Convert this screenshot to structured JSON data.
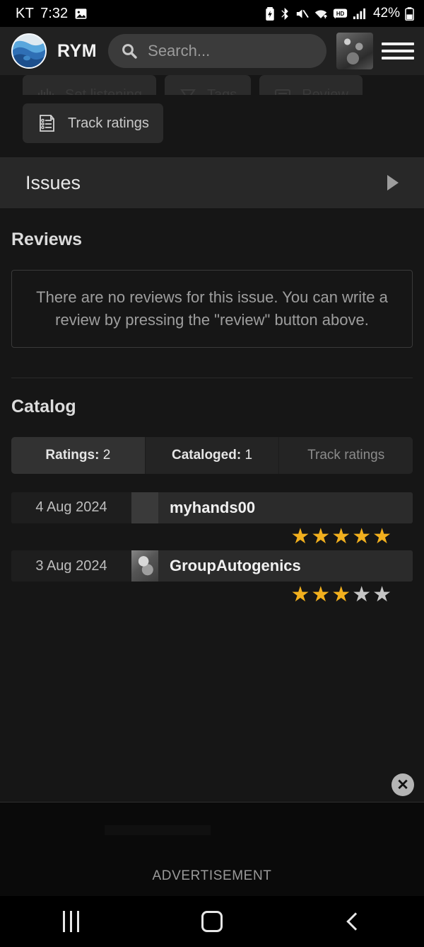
{
  "status_bar": {
    "carrier": "KT",
    "time": "7:32",
    "battery_percent": "42%",
    "icons": [
      "image-icon",
      "battery-saver-icon",
      "bluetooth-icon",
      "mute-icon",
      "wifi-icon",
      "hd-icon",
      "signal-bars-icon",
      "battery-icon"
    ]
  },
  "app_bar": {
    "brand": "RYM",
    "search_placeholder": "Search...",
    "search_value": "",
    "avatar_name": "user-avatar",
    "menu_name": "hamburger-menu"
  },
  "action_buttons_clipped": [
    {
      "label": "Set listening",
      "icon": "waveform-icon"
    },
    {
      "label": "Tags",
      "icon": "tag-icon"
    },
    {
      "label": "Review",
      "icon": "note-icon"
    }
  ],
  "action_buttons": [
    {
      "label": "Track ratings",
      "icon": "track-ratings-icon"
    }
  ],
  "issues": {
    "label": "Issues",
    "chevron": "chevron-right-icon"
  },
  "reviews": {
    "title": "Reviews",
    "empty_message": "There are no reviews for this issue. You can write a review by pressing the \"review\" button above."
  },
  "catalog": {
    "title": "Catalog",
    "tabs": [
      {
        "label": "Ratings:",
        "count": "2",
        "active": true
      },
      {
        "label": "Cataloged:",
        "count": "1",
        "active": false
      },
      {
        "label": "Track ratings",
        "count": "",
        "active": false,
        "muted": true
      }
    ],
    "ratings": [
      {
        "date": "4 Aug 2024",
        "user": "myhands00",
        "stars": 5,
        "max_stars": 5,
        "has_photo": false
      },
      {
        "date": "3 Aug 2024",
        "user": "GroupAutogenics",
        "stars": 3,
        "max_stars": 5,
        "has_photo": true
      }
    ]
  },
  "advertisement": {
    "label": "ADVERTISEMENT",
    "close_label": "✕"
  },
  "nav_bar": {
    "recents": "recents-icon",
    "home": "home-icon",
    "back": "back-icon"
  },
  "colors": {
    "page_bg": "#161616",
    "appbar_bg": "#212121",
    "card_bg": "#282828",
    "star_on": "#f2b01e",
    "star_off": "#c6c6c6",
    "text_primary": "#e8e8e8",
    "text_muted": "#9e9e9e"
  }
}
